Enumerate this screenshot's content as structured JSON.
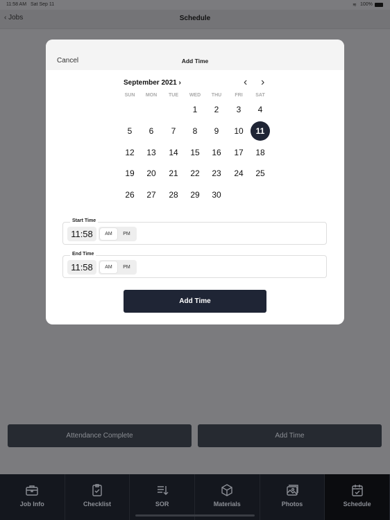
{
  "status_bar": {
    "time": "11:58 AM",
    "date": "Sat Sep 11",
    "battery": "100%"
  },
  "nav": {
    "back_label": "Jobs",
    "title": "Schedule"
  },
  "modal": {
    "cancel_label": "Cancel",
    "title": "Add Time",
    "calendar": {
      "month_label": "September 2021",
      "weekdays": [
        "SUN",
        "MON",
        "TUE",
        "WED",
        "THU",
        "FRI",
        "SAT"
      ],
      "first_weekday_index": 3,
      "days_in_month": 30,
      "selected_day": 11
    },
    "start_time": {
      "label": "Start Time",
      "value": "11:58",
      "am": "AM",
      "pm": "PM",
      "selected": "AM"
    },
    "end_time": {
      "label": "End Time",
      "value": "11:58",
      "am": "AM",
      "pm": "PM",
      "selected": "AM"
    },
    "add_button": "Add Time"
  },
  "actions": {
    "attendance_complete": "Attendance Complete",
    "add_time": "Add Time"
  },
  "tabs": [
    {
      "label": "Job Info",
      "icon": "briefcase-icon"
    },
    {
      "label": "Checklist",
      "icon": "clipboard-check-icon"
    },
    {
      "label": "SOR",
      "icon": "sort-list-icon"
    },
    {
      "label": "Materials",
      "icon": "box-icon"
    },
    {
      "label": "Photos",
      "icon": "photos-icon"
    },
    {
      "label": "Schedule",
      "icon": "calendar-check-icon",
      "active": true
    }
  ],
  "colors": {
    "accent": "#1f2535",
    "overlay": "#7b7b7e",
    "tabbar": "#14171e"
  }
}
